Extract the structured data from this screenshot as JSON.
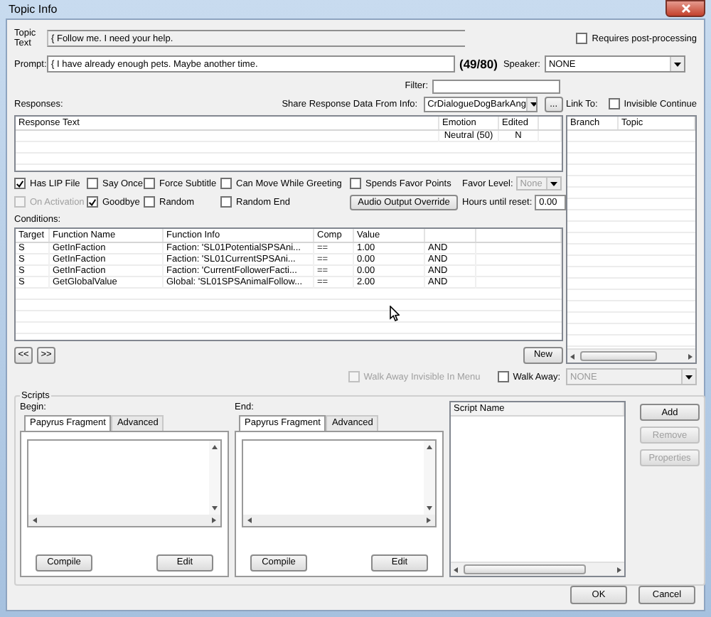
{
  "window": {
    "title": "Topic Info"
  },
  "topic_text": {
    "label": "Topic Text",
    "value": "{ Follow me. I need your help."
  },
  "requires_post_processing": {
    "label": "Requires post-processing",
    "checked": false
  },
  "prompt": {
    "label": "Prompt:",
    "value": "{ I have already enough pets. Maybe another time.",
    "counter": "(49/80)"
  },
  "speaker": {
    "label": "Speaker:",
    "value": "NONE"
  },
  "filter": {
    "label": "Filter:"
  },
  "responses": {
    "label": "Responses:",
    "columns": [
      "Response Text",
      "Emotion",
      "Edited"
    ],
    "rows": [
      {
        "emotion": "Neutral (50)",
        "edited": "N"
      }
    ]
  },
  "share_response": {
    "label": "Share Response Data From Info:",
    "value": "CrDialogueDogBarkAng",
    "browse_button": "..."
  },
  "link_to": {
    "label": "Link To:",
    "columns": [
      "Branch",
      "Topic"
    ]
  },
  "invisible_continue": {
    "label": "Invisible Continue",
    "checked": false
  },
  "flags": [
    {
      "label": "Has LIP File",
      "checked": true,
      "disabled": false
    },
    {
      "label": "Say Once",
      "checked": false,
      "disabled": false
    },
    {
      "label": "Force Subtitle",
      "checked": false,
      "disabled": false
    },
    {
      "label": "Can Move While Greeting",
      "checked": false,
      "disabled": false
    },
    {
      "label": "Spends Favor Points",
      "checked": false,
      "disabled": false
    },
    {
      "label": "On Activation",
      "checked": false,
      "disabled": true
    },
    {
      "label": "Goodbye",
      "checked": true,
      "disabled": false
    },
    {
      "label": "Random",
      "checked": false,
      "disabled": false
    },
    {
      "label": "Random End",
      "checked": false,
      "disabled": false
    }
  ],
  "audio_output_override": "Audio Output Override",
  "favor_level": {
    "label": "Favor Level:",
    "value": "None",
    "disabled": true
  },
  "hours_until_reset": {
    "label": "Hours until reset:",
    "value": "0.00"
  },
  "conditions": {
    "label": "Conditions:",
    "columns": [
      "Target",
      "Function Name",
      "Function Info",
      "Comp",
      "Value"
    ],
    "rows": [
      [
        "S",
        "GetInFaction",
        "Faction: 'SL01PotentialSPSAni...",
        "==",
        "1.00",
        "AND"
      ],
      [
        "S",
        "GetInFaction",
        "Faction: 'SL01CurrentSPSAni...",
        "==",
        "0.00",
        "AND"
      ],
      [
        "S",
        "GetInFaction",
        "Faction: 'CurrentFollowerFacti...",
        "==",
        "0.00",
        "AND"
      ],
      [
        "S",
        "GetGlobalValue",
        "Global: 'SL01SPSAnimalFollow...",
        "==",
        "2.00",
        "AND"
      ]
    ]
  },
  "nav_buttons": [
    "<<",
    ">>"
  ],
  "new_button": "New",
  "walk_away_invisible_in_menu": {
    "label": "Walk Away Invisible In Menu",
    "checked": false,
    "disabled": true
  },
  "walk_away": {
    "label": "Walk Away:",
    "checked": false
  },
  "walk_away_topic": {
    "value": "NONE",
    "disabled": true
  },
  "scripts": {
    "title": "Scripts",
    "panels": [
      {
        "label": "Begin:",
        "tabs": [
          {
            "label": "Papyrus Fragment",
            "selected": true
          },
          {
            "label": "Advanced",
            "selected": false
          }
        ],
        "buttons": [
          "Compile",
          "Edit"
        ]
      },
      {
        "label": "End:",
        "tabs": [
          {
            "label": "Papyrus Fragment",
            "selected": true
          },
          {
            "label": "Advanced",
            "selected": false
          }
        ],
        "buttons": [
          "Compile",
          "Edit"
        ]
      }
    ],
    "list": {
      "columns": [
        "Script Name"
      ]
    },
    "buttons": [
      {
        "label": "Add",
        "disabled": false
      },
      {
        "label": "Remove",
        "disabled": true
      },
      {
        "label": "Properties",
        "disabled": true
      }
    ]
  },
  "buttons": [
    "OK",
    "Cancel"
  ]
}
